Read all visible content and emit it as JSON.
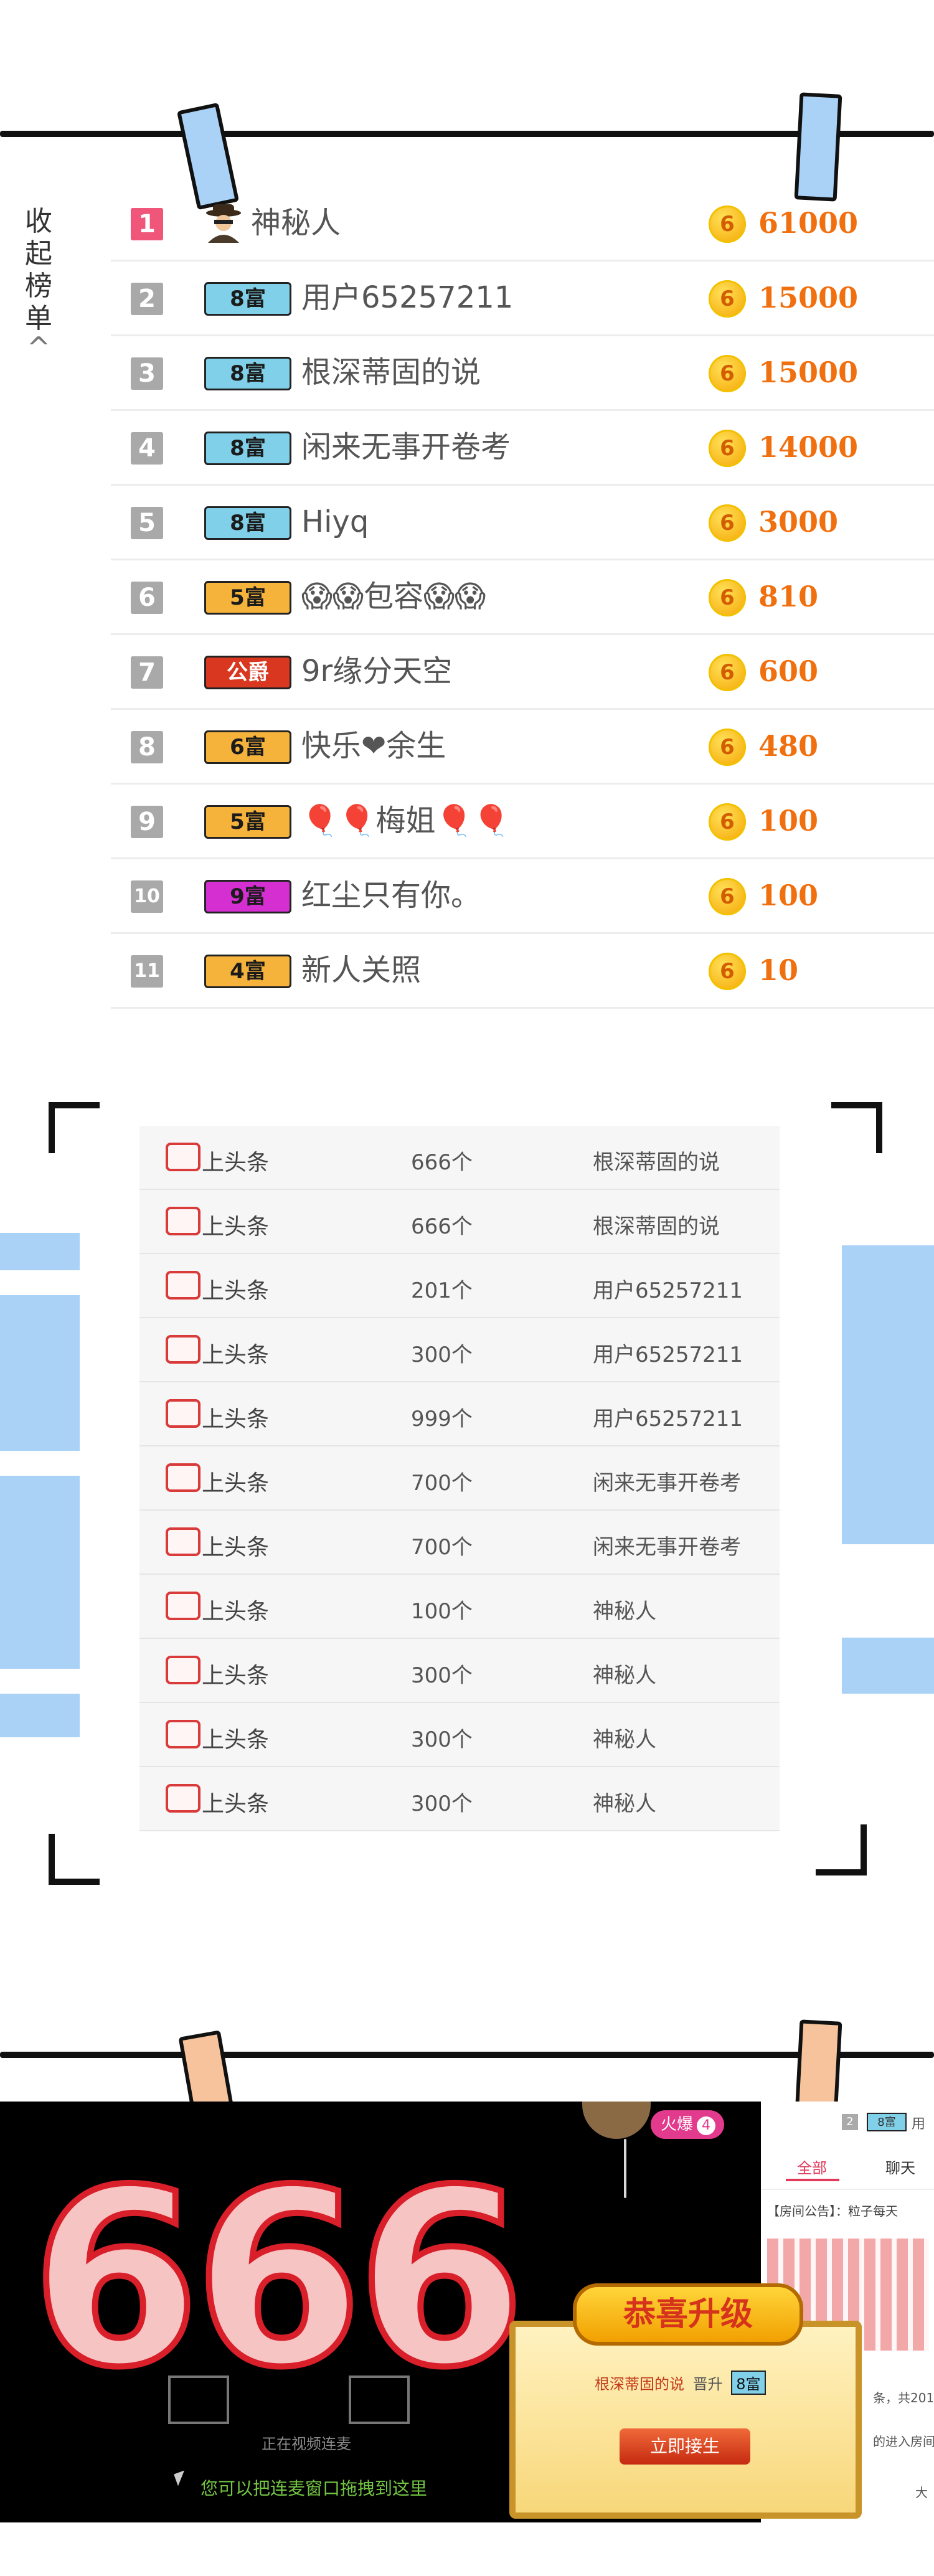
{
  "rank_panel": {
    "collapse_label": "收起榜单",
    "collapse_chevron": "^",
    "rows": [
      {
        "rank": "1",
        "badge": "",
        "name": "神秘人",
        "score": "61000",
        "coin": "6",
        "icon": "spy-icon"
      },
      {
        "rank": "2",
        "badge": "8富",
        "name": "用户65257211",
        "score": "15000",
        "coin": "6"
      },
      {
        "rank": "3",
        "badge": "8富",
        "name": "根深蒂固的说",
        "score": "15000",
        "coin": "6"
      },
      {
        "rank": "4",
        "badge": "8富",
        "name": "闲来无事开卷考",
        "score": "14000",
        "coin": "6"
      },
      {
        "rank": "5",
        "badge": "8富",
        "name": "Hiyq",
        "score": "3000",
        "coin": "6"
      },
      {
        "rank": "6",
        "badge": "5富",
        "name": "😱😱包容😱😱",
        "score": "810",
        "coin": "6"
      },
      {
        "rank": "7",
        "badge": "公爵",
        "name": "9r缘分天空",
        "score": "600",
        "coin": "6"
      },
      {
        "rank": "8",
        "badge": "6富",
        "name": "快乐❤余生",
        "score": "480",
        "coin": "6"
      },
      {
        "rank": "9",
        "badge": "5富",
        "name": "🎈🎈梅姐🎈🎈",
        "score": "100",
        "coin": "6"
      },
      {
        "rank": "10",
        "badge": "9富",
        "name": "红尘只有你。",
        "score": "100",
        "coin": "6"
      },
      {
        "rank": "11",
        "badge": "4富",
        "name": "新人关照",
        "score": "10",
        "coin": "6"
      }
    ]
  },
  "gift_table": {
    "rows": [
      {
        "gift": "上头条",
        "count": "666个",
        "user": "根深蒂固的说"
      },
      {
        "gift": "上头条",
        "count": "666个",
        "user": "根深蒂固的说"
      },
      {
        "gift": "上头条",
        "count": "201个",
        "user": "用户65257211"
      },
      {
        "gift": "上头条",
        "count": "300个",
        "user": "用户65257211"
      },
      {
        "gift": "上头条",
        "count": "999个",
        "user": "用户65257211"
      },
      {
        "gift": "上头条",
        "count": "700个",
        "user": "闲来无事开卷考"
      },
      {
        "gift": "上头条",
        "count": "700个",
        "user": "闲来无事开卷考"
      },
      {
        "gift": "上头条",
        "count": "100个",
        "user": "神秘人"
      },
      {
        "gift": "上头条",
        "count": "300个",
        "user": "神秘人"
      },
      {
        "gift": "上头条",
        "count": "300个",
        "user": "神秘人"
      },
      {
        "gift": "上头条",
        "count": "300个",
        "user": "神秘人"
      }
    ]
  },
  "stream": {
    "big_number": "666",
    "video_hint": "正在视频连麦",
    "drag_hint": "您可以把连麦窗口拖拽到这里",
    "hot_label": "火爆",
    "hot_count": "4",
    "panel": {
      "rank_num": "2",
      "rank_badge": "8富",
      "rank_name": "用",
      "tab_all": "全部",
      "tab_chat": "聊天",
      "notice": "【房间公告】：粒子每天",
      "partial_line1": "条，共201个",
      "partial_line2": "的进入房间",
      "partial_line3": "大"
    },
    "popup": {
      "title": "恭喜升级",
      "user": "根深蒂固的说",
      "text": "晋升",
      "badge": "8富",
      "button": "立即接生"
    }
  },
  "colors": {
    "badge_8": "#7fd0e8",
    "badge_5": "#f6b33c",
    "badge_9": "#d62fd1",
    "badge_duke": "#d9371f",
    "badge_6": "#f6b33c",
    "badge_4": "#f6b33c",
    "score": "#f07010"
  }
}
